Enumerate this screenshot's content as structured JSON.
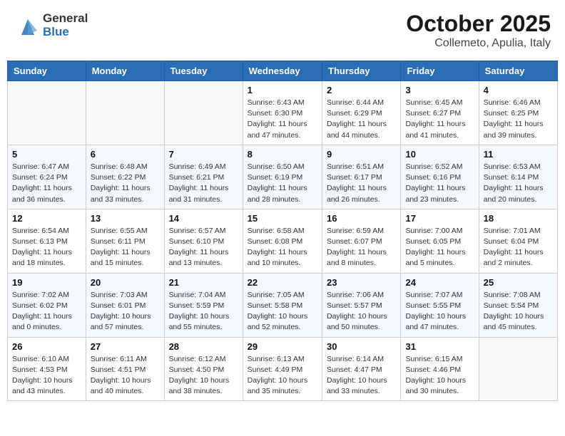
{
  "header": {
    "logo_general": "General",
    "logo_blue": "Blue",
    "month": "October 2025",
    "location": "Collemeto, Apulia, Italy"
  },
  "weekdays": [
    "Sunday",
    "Monday",
    "Tuesday",
    "Wednesday",
    "Thursday",
    "Friday",
    "Saturday"
  ],
  "weeks": [
    [
      {
        "day": "",
        "info": ""
      },
      {
        "day": "",
        "info": ""
      },
      {
        "day": "",
        "info": ""
      },
      {
        "day": "1",
        "info": "Sunrise: 6:43 AM\nSunset: 6:30 PM\nDaylight: 11 hours\nand 47 minutes."
      },
      {
        "day": "2",
        "info": "Sunrise: 6:44 AM\nSunset: 6:29 PM\nDaylight: 11 hours\nand 44 minutes."
      },
      {
        "day": "3",
        "info": "Sunrise: 6:45 AM\nSunset: 6:27 PM\nDaylight: 11 hours\nand 41 minutes."
      },
      {
        "day": "4",
        "info": "Sunrise: 6:46 AM\nSunset: 6:25 PM\nDaylight: 11 hours\nand 39 minutes."
      }
    ],
    [
      {
        "day": "5",
        "info": "Sunrise: 6:47 AM\nSunset: 6:24 PM\nDaylight: 11 hours\nand 36 minutes."
      },
      {
        "day": "6",
        "info": "Sunrise: 6:48 AM\nSunset: 6:22 PM\nDaylight: 11 hours\nand 33 minutes."
      },
      {
        "day": "7",
        "info": "Sunrise: 6:49 AM\nSunset: 6:21 PM\nDaylight: 11 hours\nand 31 minutes."
      },
      {
        "day": "8",
        "info": "Sunrise: 6:50 AM\nSunset: 6:19 PM\nDaylight: 11 hours\nand 28 minutes."
      },
      {
        "day": "9",
        "info": "Sunrise: 6:51 AM\nSunset: 6:17 PM\nDaylight: 11 hours\nand 26 minutes."
      },
      {
        "day": "10",
        "info": "Sunrise: 6:52 AM\nSunset: 6:16 PM\nDaylight: 11 hours\nand 23 minutes."
      },
      {
        "day": "11",
        "info": "Sunrise: 6:53 AM\nSunset: 6:14 PM\nDaylight: 11 hours\nand 20 minutes."
      }
    ],
    [
      {
        "day": "12",
        "info": "Sunrise: 6:54 AM\nSunset: 6:13 PM\nDaylight: 11 hours\nand 18 minutes."
      },
      {
        "day": "13",
        "info": "Sunrise: 6:55 AM\nSunset: 6:11 PM\nDaylight: 11 hours\nand 15 minutes."
      },
      {
        "day": "14",
        "info": "Sunrise: 6:57 AM\nSunset: 6:10 PM\nDaylight: 11 hours\nand 13 minutes."
      },
      {
        "day": "15",
        "info": "Sunrise: 6:58 AM\nSunset: 6:08 PM\nDaylight: 11 hours\nand 10 minutes."
      },
      {
        "day": "16",
        "info": "Sunrise: 6:59 AM\nSunset: 6:07 PM\nDaylight: 11 hours\nand 8 minutes."
      },
      {
        "day": "17",
        "info": "Sunrise: 7:00 AM\nSunset: 6:05 PM\nDaylight: 11 hours\nand 5 minutes."
      },
      {
        "day": "18",
        "info": "Sunrise: 7:01 AM\nSunset: 6:04 PM\nDaylight: 11 hours\nand 2 minutes."
      }
    ],
    [
      {
        "day": "19",
        "info": "Sunrise: 7:02 AM\nSunset: 6:02 PM\nDaylight: 11 hours\nand 0 minutes."
      },
      {
        "day": "20",
        "info": "Sunrise: 7:03 AM\nSunset: 6:01 PM\nDaylight: 10 hours\nand 57 minutes."
      },
      {
        "day": "21",
        "info": "Sunrise: 7:04 AM\nSunset: 5:59 PM\nDaylight: 10 hours\nand 55 minutes."
      },
      {
        "day": "22",
        "info": "Sunrise: 7:05 AM\nSunset: 5:58 PM\nDaylight: 10 hours\nand 52 minutes."
      },
      {
        "day": "23",
        "info": "Sunrise: 7:06 AM\nSunset: 5:57 PM\nDaylight: 10 hours\nand 50 minutes."
      },
      {
        "day": "24",
        "info": "Sunrise: 7:07 AM\nSunset: 5:55 PM\nDaylight: 10 hours\nand 47 minutes."
      },
      {
        "day": "25",
        "info": "Sunrise: 7:08 AM\nSunset: 5:54 PM\nDaylight: 10 hours\nand 45 minutes."
      }
    ],
    [
      {
        "day": "26",
        "info": "Sunrise: 6:10 AM\nSunset: 4:53 PM\nDaylight: 10 hours\nand 43 minutes."
      },
      {
        "day": "27",
        "info": "Sunrise: 6:11 AM\nSunset: 4:51 PM\nDaylight: 10 hours\nand 40 minutes."
      },
      {
        "day": "28",
        "info": "Sunrise: 6:12 AM\nSunset: 4:50 PM\nDaylight: 10 hours\nand 38 minutes."
      },
      {
        "day": "29",
        "info": "Sunrise: 6:13 AM\nSunset: 4:49 PM\nDaylight: 10 hours\nand 35 minutes."
      },
      {
        "day": "30",
        "info": "Sunrise: 6:14 AM\nSunset: 4:47 PM\nDaylight: 10 hours\nand 33 minutes."
      },
      {
        "day": "31",
        "info": "Sunrise: 6:15 AM\nSunset: 4:46 PM\nDaylight: 10 hours\nand 30 minutes."
      },
      {
        "day": "",
        "info": ""
      }
    ]
  ]
}
